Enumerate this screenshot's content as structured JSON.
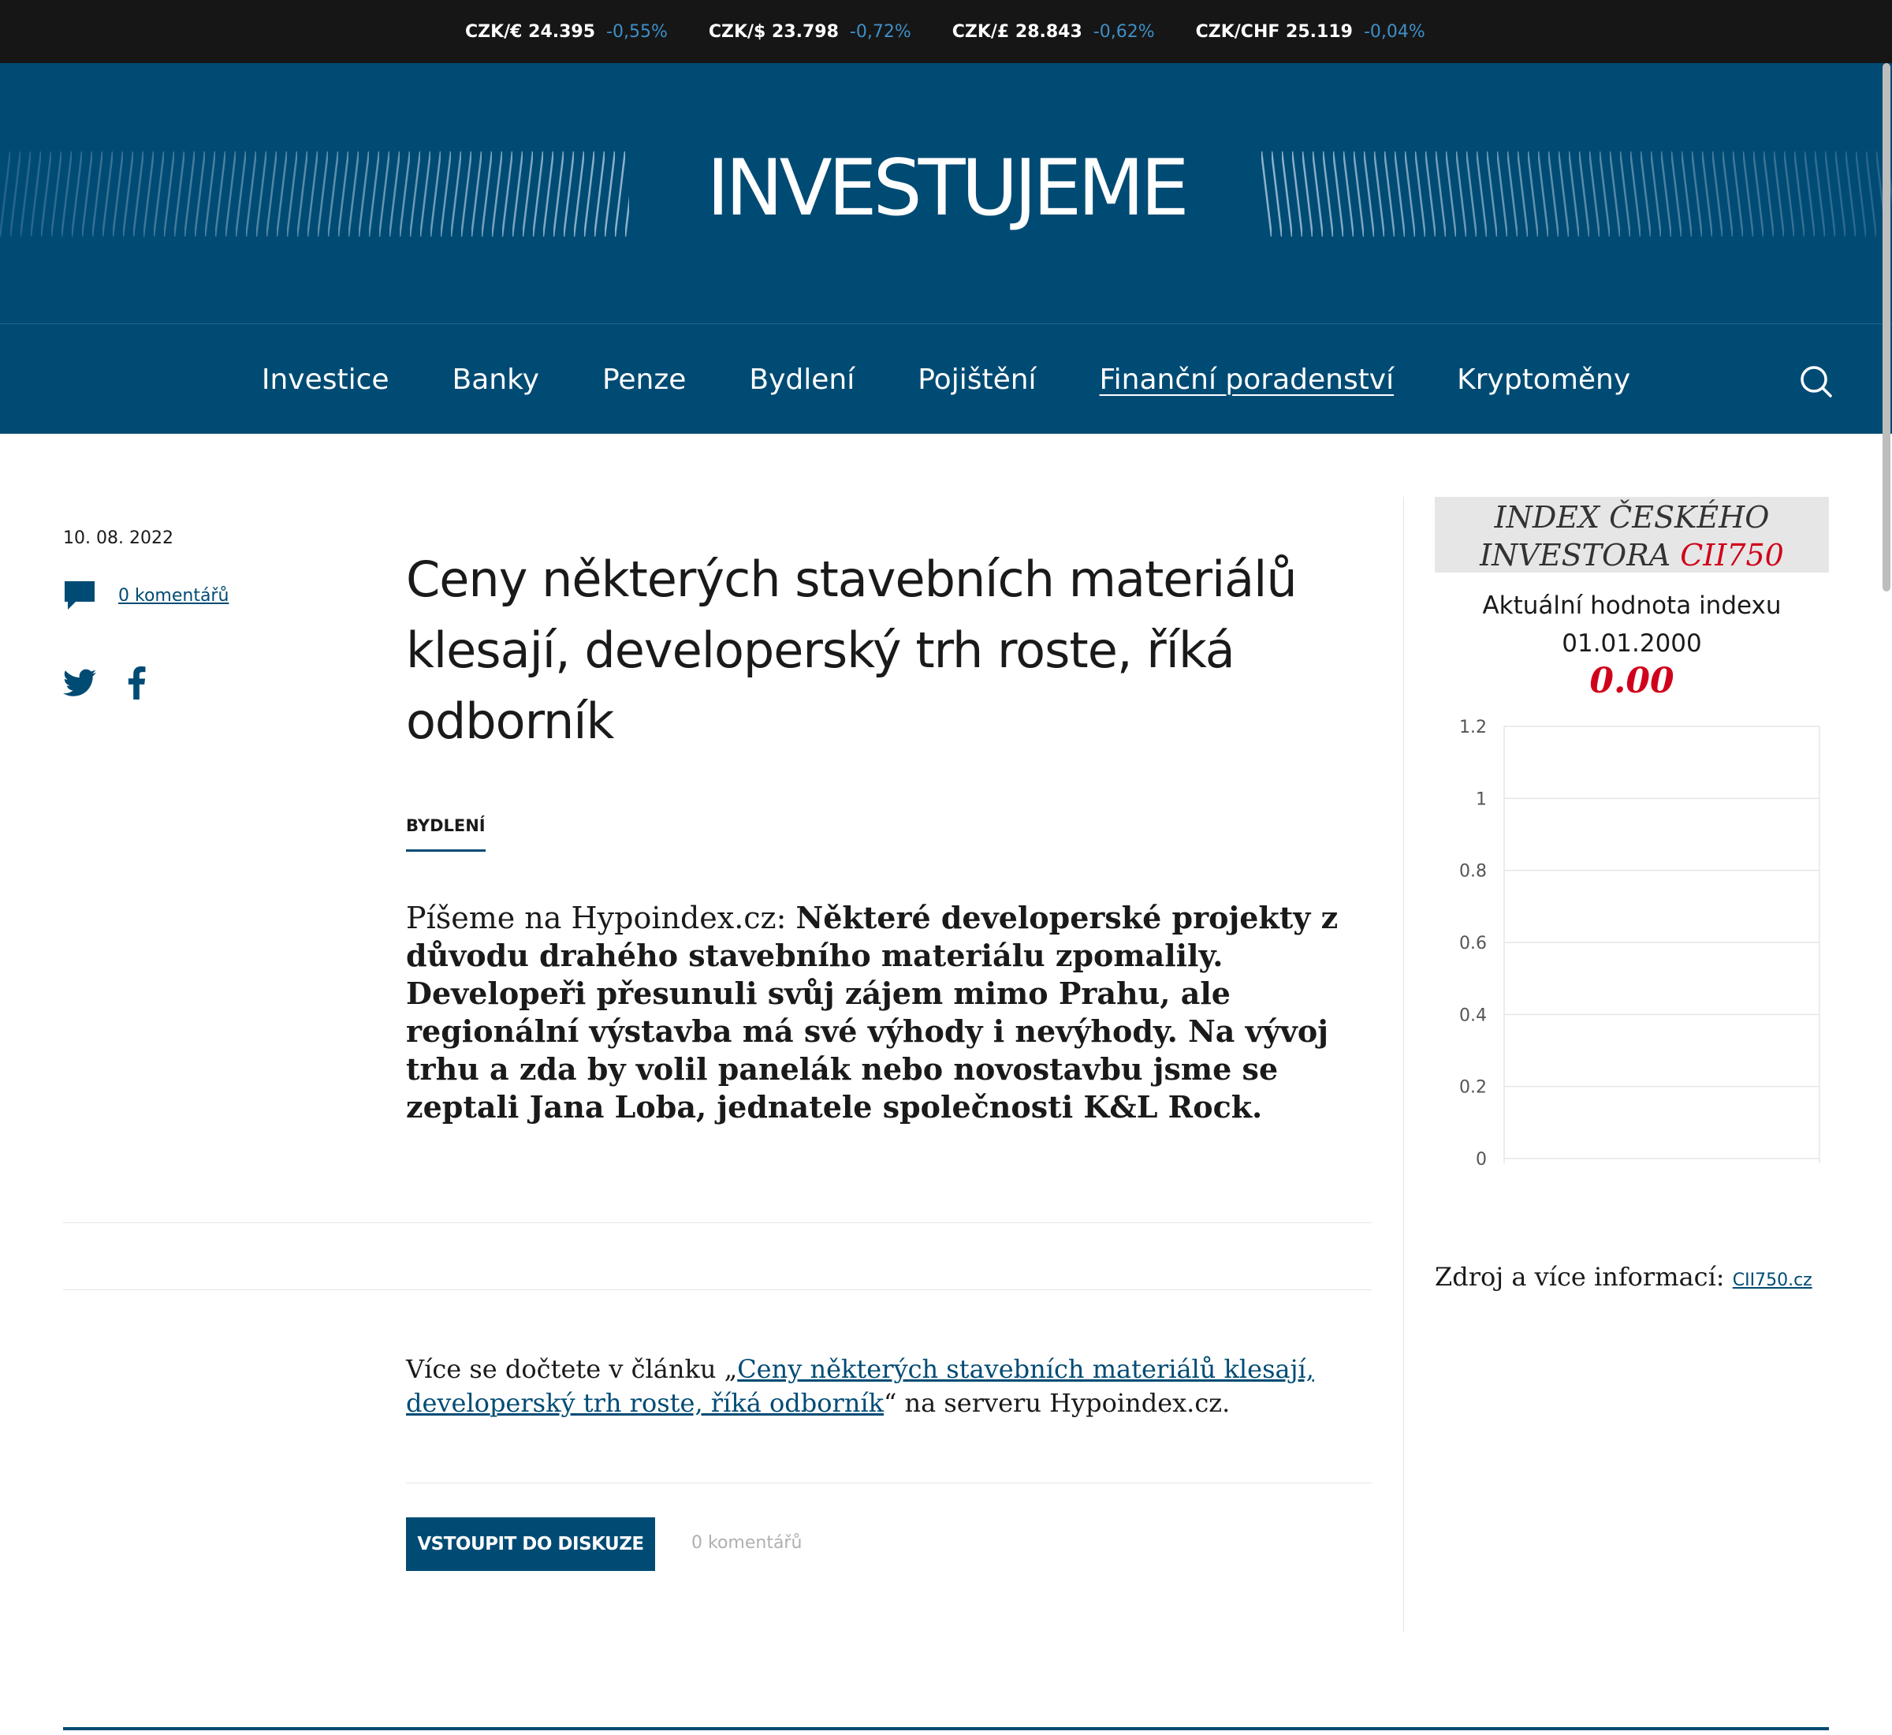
{
  "ticker": [
    {
      "label": "CZK/€ 24.395",
      "change": "-0,55%"
    },
    {
      "label": "CZK/$ 23.798",
      "change": "-0,72%"
    },
    {
      "label": "CZK/£ 28.843",
      "change": "-0,62%"
    },
    {
      "label": "CZK/CHF 25.119",
      "change": "-0,04%"
    }
  ],
  "site": {
    "logo": "INVESTUJEME"
  },
  "nav": {
    "items": [
      "Investice",
      "Banky",
      "Penze",
      "Bydlení",
      "Pojištění",
      "Finanční poradenství",
      "Kryptoměny"
    ],
    "active": "Finanční poradenství",
    "search_icon": "search-icon"
  },
  "article": {
    "date": "10. 08. 2022",
    "comments_link": "0 komentářů",
    "headline": "Ceny některých stavebních materiálů klesají, developerský trh roste, říká odborník",
    "category": "BYDLENÍ",
    "perex_lead": "Píšeme na Hypoindex.cz: ",
    "perex_body": "Některé developerské projekty z důvodu drahého stavebního materiálu zpomalily. Developeři přesunuli svůj zájem mimo Prahu, ale regionální výstavba má své výhody i nevýhody. Na vývoj trhu a zda by volil panelák nebo novostavbu jsme se zeptali Jana Loba, jednatele společnosti K&L Rock.",
    "more_prefix": "Více se dočtete v článku „",
    "more_link": "Ceny některých stavebních materiálů klesají, developerský trh roste, říká odborník",
    "more_suffix": "“ na serveru Hypoindex.cz.",
    "discuss_button": "VSTOUPIT DO DISKUZE",
    "discuss_count": "0 komentářů"
  },
  "widget": {
    "title_line1": "INDEX ČESKÉHO",
    "title_line2": "INVESTORA ",
    "title_code": "CII750",
    "subtitle": "Aktuální hodnota indexu",
    "date": "01.01.2000",
    "value": "0.00",
    "source_label": "Zdroj a více informací: ",
    "source_link": "CII750.cz"
  },
  "chart_data": {
    "type": "line",
    "x": [],
    "series": [],
    "yticks": [
      "1.2",
      "1",
      "0.8",
      "0.6",
      "0.4",
      "0.2",
      "0"
    ],
    "ylim": [
      0,
      1.2
    ],
    "grid": true
  },
  "colors": {
    "brand": "#004b74",
    "accent_red": "#d0021b",
    "ticker_change": "#3d8fc7"
  }
}
